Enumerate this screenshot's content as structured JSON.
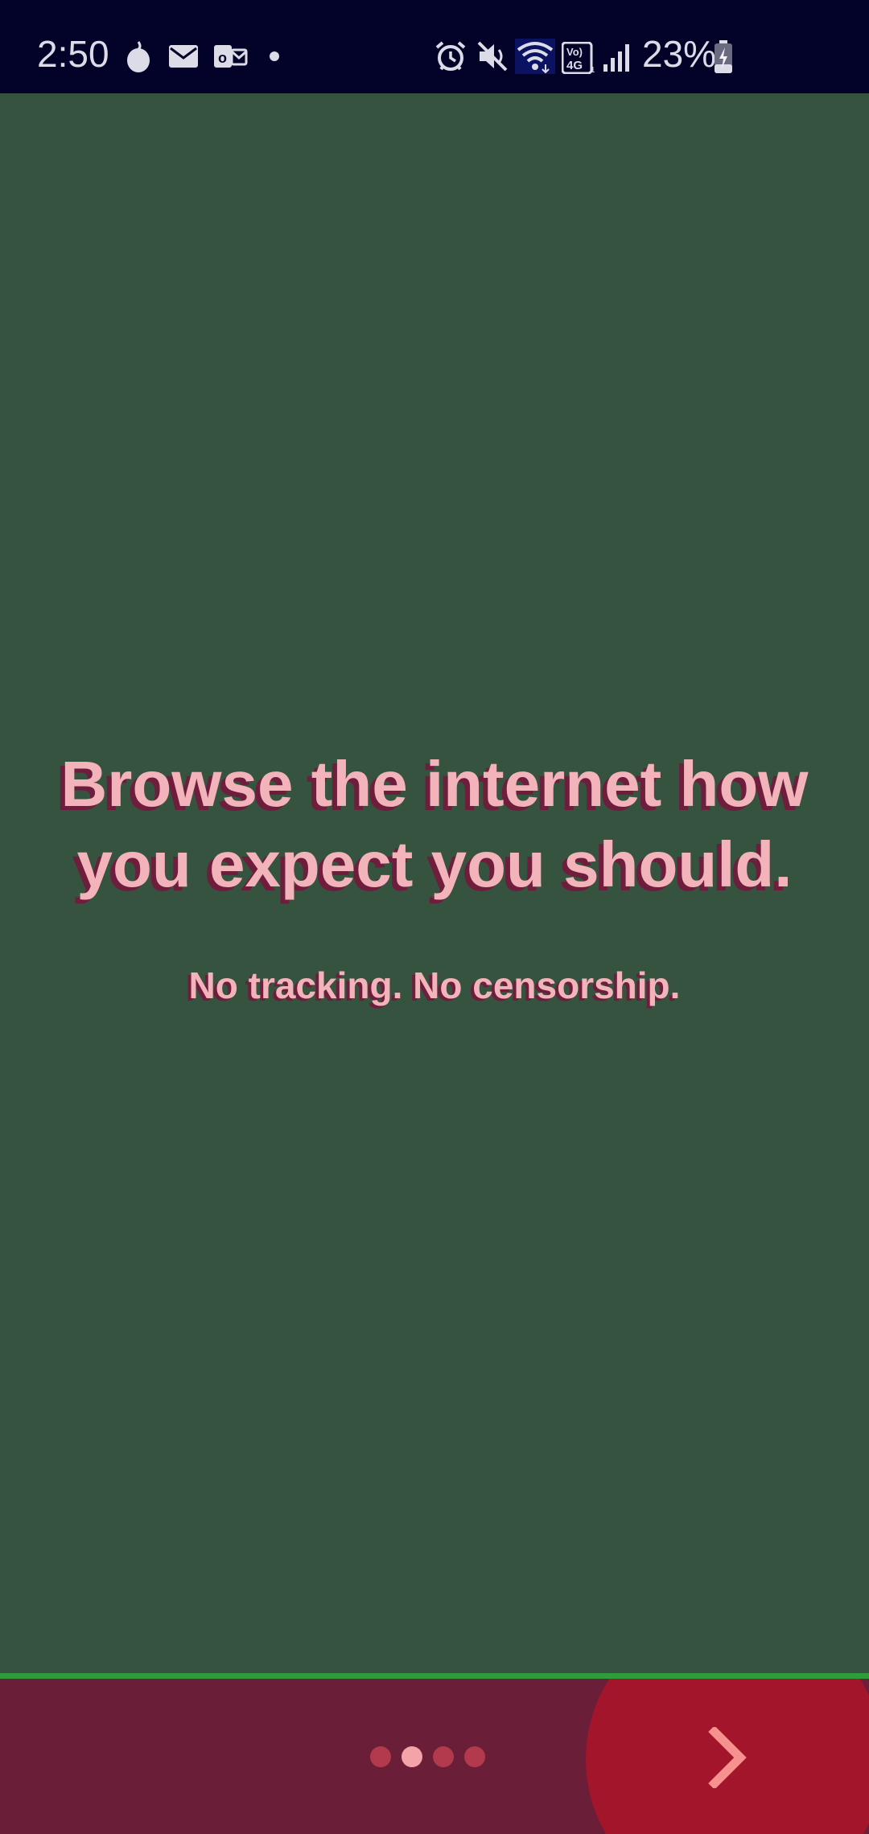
{
  "status_bar": {
    "time": "2:50",
    "battery_percent": "23%",
    "icons": [
      "notification-bubble-icon",
      "mail-icon",
      "outlook-icon",
      "dot-icon",
      "alarm-icon",
      "mute-icon",
      "wifi-icon",
      "volte-4g-icon",
      "signal-icon",
      "battery-charging-icon"
    ]
  },
  "onboarding": {
    "headline_line1": "Browse the internet how",
    "headline_line2": "you expect you should.",
    "subline": "No tracking. No censorship.",
    "page_count": 4,
    "current_page": 2,
    "next_icon": "chevron-right-icon"
  },
  "colors": {
    "background": "#36533f",
    "status_bar": "#03032a",
    "text": "#f2b3ba",
    "text_shadow": "#6e1e3c",
    "divider": "#2e9c3a",
    "bottom_bar": "#6b1e38",
    "next_button": "#a2152b",
    "dot": "#b33a4c",
    "dot_active": "#f4a4a8"
  }
}
